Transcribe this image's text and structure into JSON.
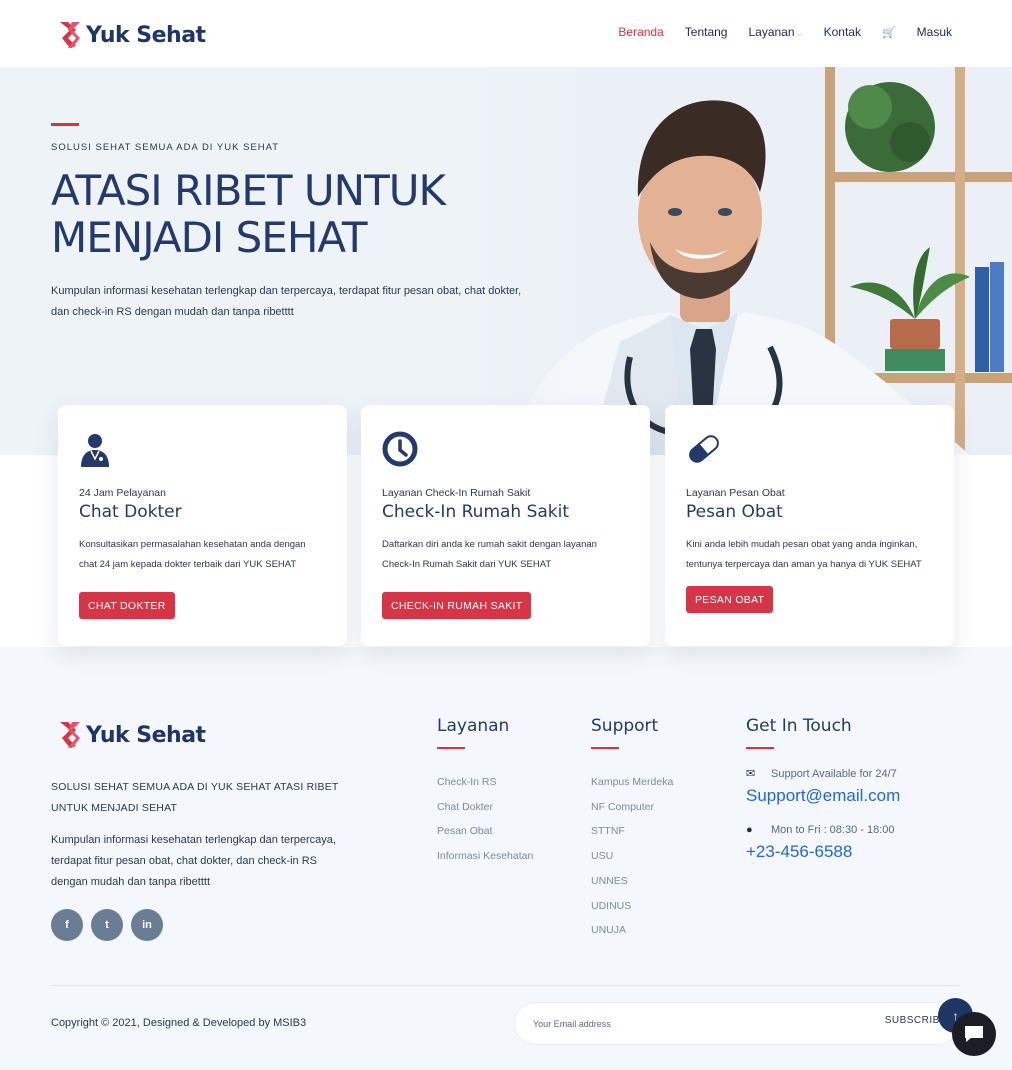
{
  "brand": {
    "name": "Yuk Sehat",
    "accent": "#d63447",
    "navy": "#243a6b"
  },
  "nav": {
    "items": [
      {
        "label": "Beranda",
        "active": true
      },
      {
        "label": "Tentang"
      },
      {
        "label": "Layanan"
      },
      {
        "label": "Kontak"
      }
    ],
    "cart_icon": "cart-icon",
    "login": "Masuk"
  },
  "hero": {
    "kicker": "SOLUSI SEHAT SEMUA ADA DI YUK SEHAT",
    "title_line1": "ATASI RIBET UNTUK",
    "title_line2": "MENJADI SEHAT",
    "desc_line1": "Kumpulan informasi kesehatan terlengkap dan terpercaya, terdapat fitur pesan obat, chat dokter,",
    "desc_line2": "dan check-in RS dengan mudah dan tanpa ribetttt"
  },
  "services": [
    {
      "icon": "doctor-icon",
      "subtitle": "24 Jam Pelayanan",
      "title": "Chat Dokter",
      "desc_line1": "Konsultasikan permasalahan kesehatan anda dengan",
      "desc_line2": "chat 24 jam kepada dokter terbaik dari YUK SEHAT",
      "button": "CHAT DOKTER"
    },
    {
      "icon": "clock-icon",
      "subtitle": "Layanan Check-In Rumah Sakit",
      "title": "Check-In Rumah Sakit",
      "desc_line1": "Daftarkan diri anda ke rumah sakit dengan layanan",
      "desc_line2": "Check-In Rumah Sakit dari YUK SEHAT",
      "button": "CHECK-IN RUMAH SAKIT"
    },
    {
      "icon": "pill-icon",
      "subtitle": "Layanan Pesan Obat",
      "title": "Pesan Obat",
      "desc_line1": "Kini anda lebih mudah pesan obat yang anda inginkan,",
      "desc_line2": "tentunya terpercaya dan aman ya hanya di YUK SEHAT",
      "button": "PESAN OBAT"
    }
  ],
  "footer": {
    "tagline_line1": "SOLUSI SEHAT SEMUA ADA DI YUK SEHAT ATASI RIBET",
    "tagline_line2": "UNTUK MENJADI SEHAT",
    "desc_line1": "Kumpulan informasi kesehatan terlengkap dan terpercaya,",
    "desc_line2": "terdapat fitur pesan obat, chat dokter, dan check-in RS",
    "desc_line3": "dengan mudah dan tanpa ribetttt",
    "socials": [
      {
        "icon": "facebook-icon",
        "glyph": "f"
      },
      {
        "icon": "twitter-icon",
        "glyph": "t"
      },
      {
        "icon": "linkedin-icon",
        "glyph": "in"
      }
    ],
    "layanan": {
      "heading": "Layanan",
      "links": [
        "Check-In RS",
        "Chat Dokter",
        "Pesan Obat",
        "Informasi Kesehatan"
      ]
    },
    "support": {
      "heading": "Support",
      "links": [
        "Kampus Merdeka",
        "NF Computer",
        "STTNF",
        "USU",
        "UNNES",
        "UDINUS",
        "UNUJA"
      ]
    },
    "contact": {
      "heading": "Get In Touch",
      "email_note": "Support Available for 24/7",
      "email": "Support@email.com",
      "hours": "Mon to Fri : 08:30 - 18:00",
      "phone": "+23-456-6588"
    },
    "copyright": "Copyright © 2021, Designed & Developed by MSIB3",
    "subscribe": {
      "placeholder": "Your Email address",
      "button": "SUBSCRIBE"
    }
  }
}
